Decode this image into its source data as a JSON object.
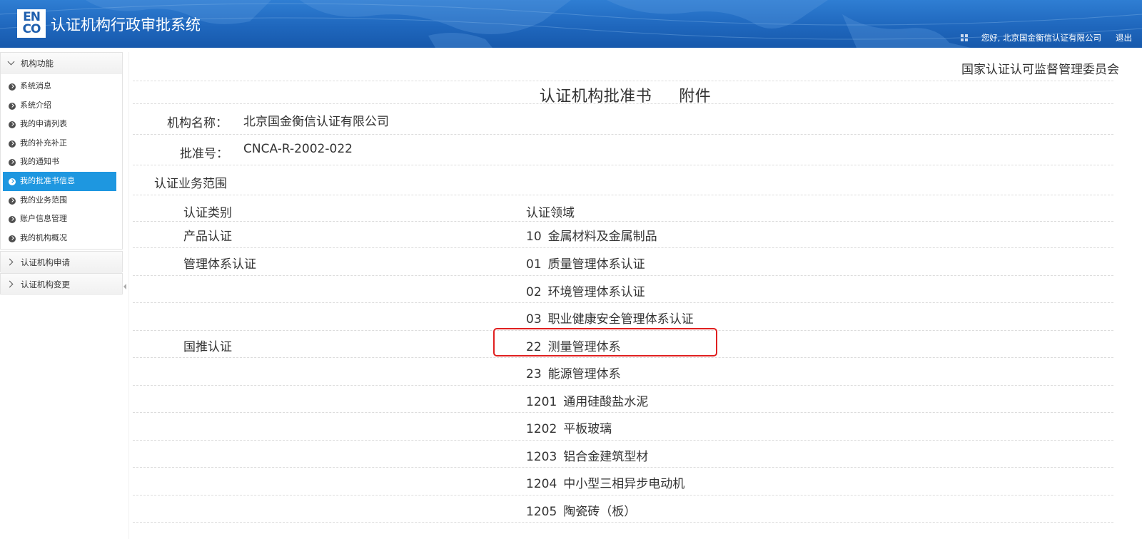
{
  "header": {
    "logo_top": "EN",
    "logo_bottom": "CO",
    "app_title": "认证机构行政审批系统",
    "greeting": "您好, 北京国金衡信认证有限公司",
    "logout": "退出"
  },
  "sidebar": {
    "panel_title": "机构功能",
    "items": [
      {
        "label": "系统消息"
      },
      {
        "label": "系统介绍"
      },
      {
        "label": "我的申请列表"
      },
      {
        "label": "我的补充补正"
      },
      {
        "label": "我的通知书"
      },
      {
        "label": "我的批准书信息",
        "active": true
      },
      {
        "label": "我的业务范围"
      },
      {
        "label": "账户信息管理"
      },
      {
        "label": "我的机构概况"
      }
    ],
    "group2": "认证机构申请",
    "group3": "认证机构变更"
  },
  "main": {
    "issuer": "国家认证认可监督管理委员会",
    "title": "认证机构批准书",
    "title_suffix": "附件",
    "org_label": "机构名称：",
    "org_value": "北京国金衡信认证有限公司",
    "approval_label": "批准号：",
    "approval_value": "CNCA-R-2002-022",
    "scope_heading": "认证业务范围",
    "table": {
      "headers": [
        "认证类别",
        "认证领域"
      ],
      "rows": [
        {
          "category": "产品认证",
          "code": "10",
          "domain": "金属材料及金属制品"
        },
        {
          "category": "管理体系认证",
          "code": "01",
          "domain": "质量管理体系认证"
        },
        {
          "category": "",
          "code": "02",
          "domain": "环境管理体系认证"
        },
        {
          "category": "",
          "code": "03",
          "domain": "职业健康安全管理体系认证"
        },
        {
          "category": "国推认证",
          "code": "22",
          "domain": "测量管理体系"
        },
        {
          "category": "",
          "code": "23",
          "domain": "能源管理体系"
        },
        {
          "category": "",
          "code": "1201",
          "domain": "通用硅酸盐水泥"
        },
        {
          "category": "",
          "code": "1202",
          "domain": "平板玻璃"
        },
        {
          "category": "",
          "code": "1203",
          "domain": "铝合金建筑型材"
        },
        {
          "category": "",
          "code": "1204",
          "domain": "中小型三相异步电动机"
        },
        {
          "category": "",
          "code": "1205",
          "domain": "陶瓷砖（板）"
        }
      ]
    },
    "highlight_color": "#e02020"
  }
}
